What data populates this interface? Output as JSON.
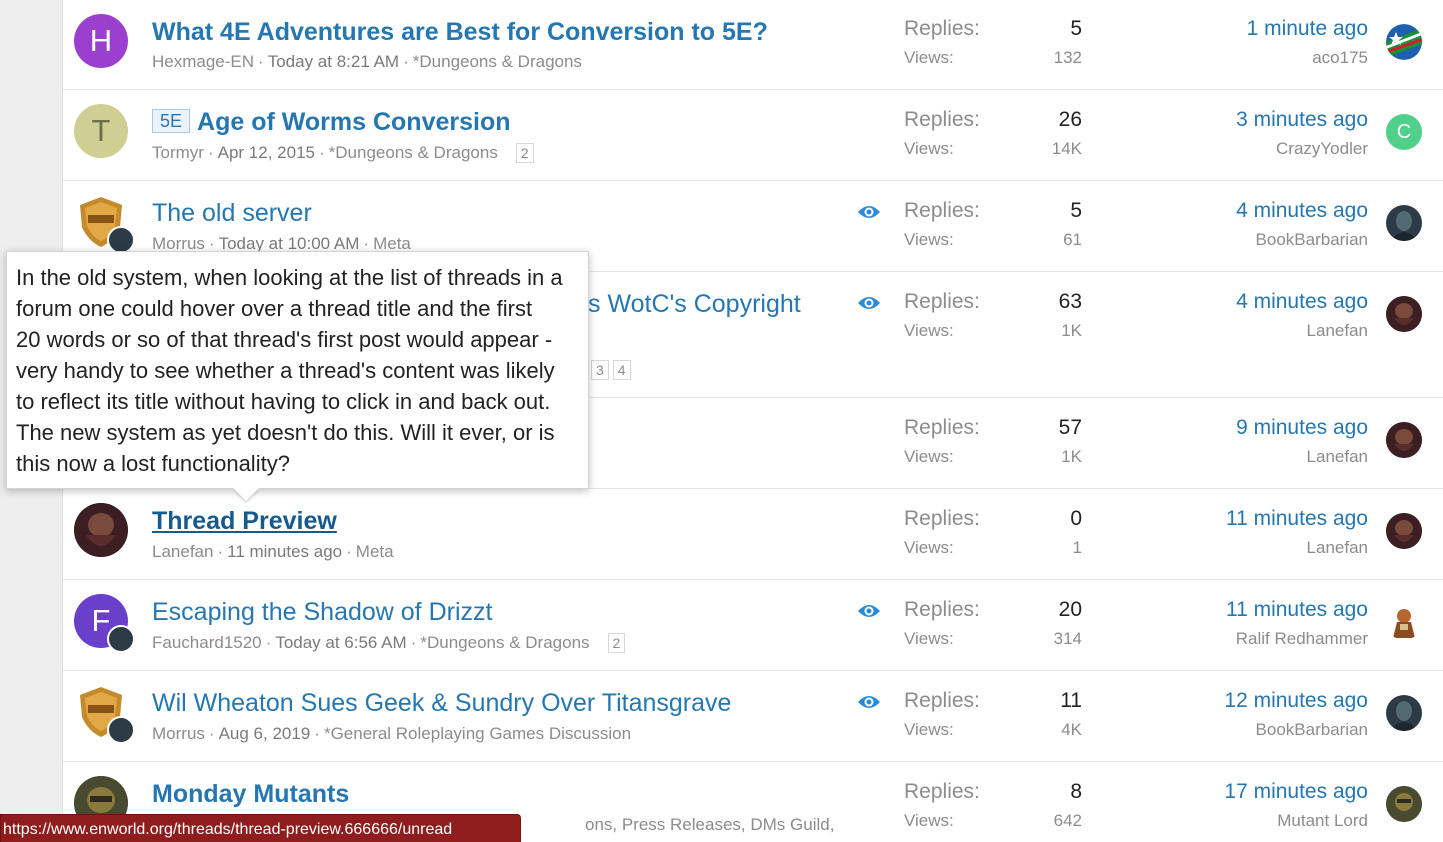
{
  "threads": [
    {
      "avatar_letter": "H",
      "avatar_color": "#9b3fce",
      "title": "What 4E Adventures are Best for Conversion to 5E?",
      "author": "Hexmage-EN",
      "date": "Today at 8:21 AM",
      "forum": "*Dungeons & Dragons",
      "replies_label": "Replies:",
      "replies": "5",
      "views_label": "Views:",
      "views": "132",
      "last_time": "1 minute ago",
      "last_user": "aco175"
    },
    {
      "avatar_letter": "T",
      "avatar_color": "#cfcf94",
      "prefix": "5E",
      "title": "Age of Worms Conversion",
      "author": "Tormyr",
      "date": "Apr 12, 2015",
      "forum": "*Dungeons & Dragons",
      "pages": [
        "2"
      ],
      "replies_label": "Replies:",
      "replies": "26",
      "views_label": "Views:",
      "views": "14K",
      "last_time": "3 minutes ago",
      "last_user": "CrazyYodler",
      "last_avatar_letter": "C",
      "last_avatar_color": "#4fd18b"
    },
    {
      "title": "The old server",
      "author": "Morrus",
      "date": "Today at 10:00 AM",
      "forum": "Meta",
      "replies_label": "Replies:",
      "replies": "5",
      "views_label": "Views:",
      "views": "61",
      "last_time": "4 minutes ago",
      "last_user": "BookBarbarian"
    },
    {
      "title_visible": "s WotC's Copyright",
      "pages": [
        "3",
        "4"
      ],
      "replies_label": "Replies:",
      "replies": "63",
      "views_label": "Views:",
      "views": "1K",
      "last_time": "4 minutes ago",
      "last_user": "Lanefan"
    },
    {
      "replies_label": "Replies:",
      "replies": "57",
      "views_label": "Views:",
      "views": "1K",
      "last_time": "9 minutes ago",
      "last_user": "Lanefan"
    },
    {
      "title": "Thread Preview",
      "author": "Lanefan",
      "date": "11 minutes ago",
      "forum": "Meta",
      "replies_label": "Replies:",
      "replies": "0",
      "views_label": "Views:",
      "views": "1",
      "last_time": "11 minutes ago",
      "last_user": "Lanefan"
    },
    {
      "avatar_letter": "F",
      "avatar_color": "#6a3fc9",
      "title": "Escaping the Shadow of Drizzt",
      "author": "Fauchard1520",
      "date": "Today at 6:56 AM",
      "forum": "*Dungeons & Dragons",
      "pages": [
        "2"
      ],
      "replies_label": "Replies:",
      "replies": "20",
      "views_label": "Views:",
      "views": "314",
      "last_time": "11 minutes ago",
      "last_user": "Ralif Redhammer"
    },
    {
      "title": "Wil Wheaton Sues Geek & Sundry Over Titansgrave",
      "author": "Morrus",
      "date": "Aug 6, 2019",
      "forum": "*General Roleplaying Games Discussion",
      "replies_label": "Replies:",
      "replies": "11",
      "views_label": "Views:",
      "views": "4K",
      "last_time": "12 minutes ago",
      "last_user": "BookBarbarian"
    },
    {
      "title": "Monday Mutants",
      "meta_visible": "ons, Press Releases, DMs Guild,",
      "replies_label": "Replies:",
      "replies": "8",
      "views_label": "Views:",
      "views": "642",
      "last_time": "17 minutes ago",
      "last_user": "Mutant Lord"
    }
  ],
  "tooltip": {
    "lines": [
      "In the old system, when looking at the list of threads in a",
      "forum one could hover over a thread title and the first",
      "20 words or so of that thread's first post would appear -",
      "very handy to see whether a thread's content was likely",
      "to reflect its title without having to click in and back out.",
      "The new system as yet doesn't do this. Will it ever, or is",
      "this now a lost functionality?"
    ]
  },
  "status_url": "https://www.enworld.org/threads/thread-preview.666666/unread",
  "colors": {
    "link": "#2577b1",
    "muted": "#8c8c8c",
    "status_bar": "#8f1d1d"
  },
  "icons": {
    "watch": "eye-icon"
  }
}
